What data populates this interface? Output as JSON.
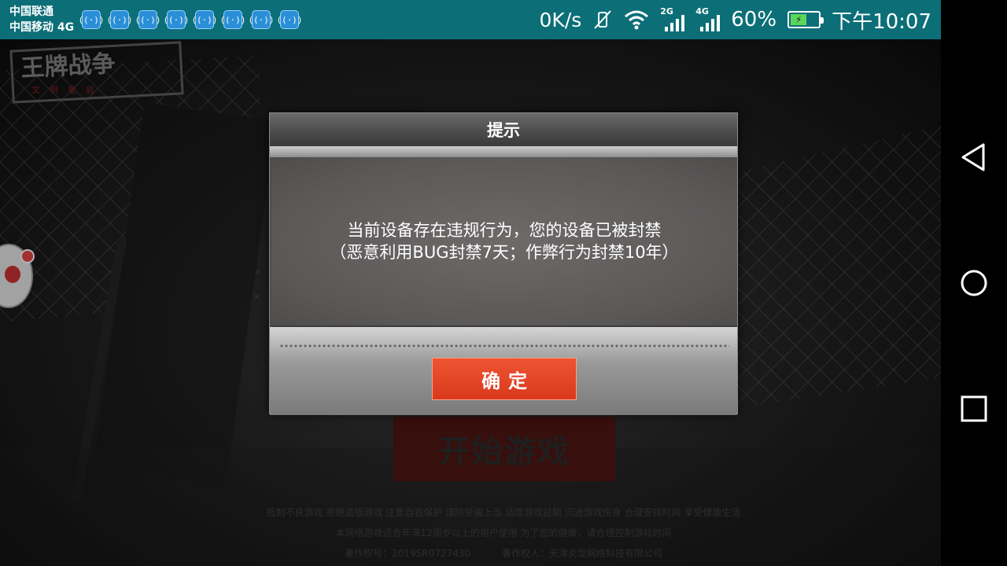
{
  "status_bar": {
    "carrier_1": "中国联通",
    "carrier_2": "中国移动 4G",
    "notification_icon_count": 8,
    "network_speed": "0K/s",
    "sim1_type": "2G",
    "sim2_type": "4G",
    "battery_percent": "60%",
    "battery_level": 0.6,
    "time": "下午10:07",
    "background_color": "#0c6f78"
  },
  "game": {
    "logo_text": "王牌战争",
    "logo_subtitle": "文明重启",
    "start_button_label": "开始游戏",
    "footer_line_1": "抵制不良游戏 拒绝盗版游戏 注意自我保护 谨防受骗上当 适度游戏益脑 沉迷游戏伤身 合理安排时间 享受健康生活",
    "footer_line_2": "本网络游戏适合年满12周岁以上的用户使用  为了您的健康，请合理控制游戏时间",
    "copyright_no": "著作权号：2019SR0727430",
    "copyright_owner": "著作权人：天津炎龙网络科技有限公司"
  },
  "dialog": {
    "title": "提示",
    "message_line_1": "当前设备存在违规行为，您的设备已被封禁",
    "message_line_2": "（恶意利用BUG封禁7天；作弊行为封禁10年）",
    "confirm_label": "确定",
    "confirm_color": "#e2441f"
  },
  "nav_bar": {
    "buttons": [
      "back-icon",
      "home-icon",
      "recent-apps-icon"
    ]
  }
}
